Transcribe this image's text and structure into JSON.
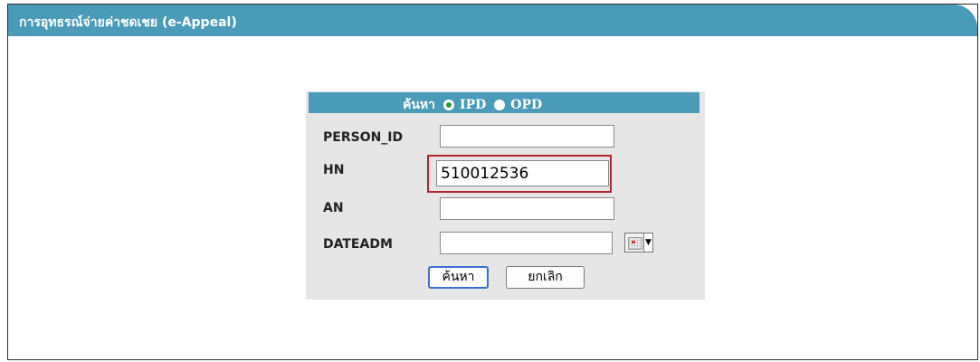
{
  "window": {
    "title": "การอุทธรณ์จ่ายค่าชดเชย (e-Appeal)"
  },
  "search_panel": {
    "header_label": "ค้นหา",
    "options": [
      {
        "label": "IPD",
        "checked": true
      },
      {
        "label": "OPD",
        "checked": false
      }
    ]
  },
  "fields": {
    "person_id": {
      "label": "PERSON_ID",
      "value": ""
    },
    "hn": {
      "label": "HN",
      "value": "510012536"
    },
    "an": {
      "label": "AN",
      "value": ""
    },
    "dateadm": {
      "label": "DATEADM",
      "value": ""
    }
  },
  "buttons": {
    "search": "ค้นหา",
    "cancel": "ยกเลิก"
  },
  "colors": {
    "header_bg": "#4a9bb7",
    "panel_bg": "#e6e6e6",
    "highlight_border": "#b0262a"
  },
  "icons": {
    "calendar": "calendar-icon",
    "dropdown": "chevron-down-icon"
  }
}
